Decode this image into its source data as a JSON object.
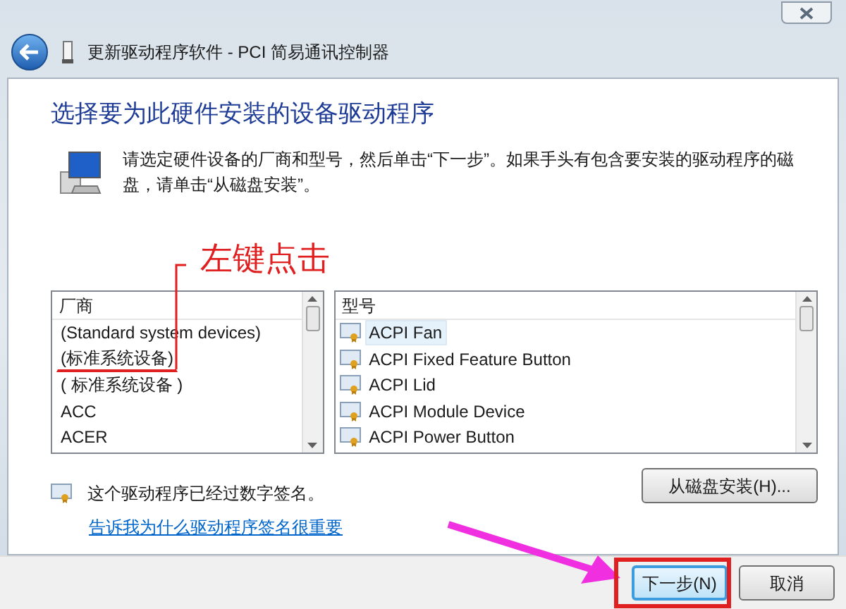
{
  "window": {
    "title": "更新驱动程序软件 - PCI 简易通讯控制器"
  },
  "heading": "选择要为此硬件安装的设备驱动程序",
  "description": "请选定硬件设备的厂商和型号，然后单击“下一步”。如果手头有包含要安装的驱动程序的磁盘，请单击“从磁盘安装”。",
  "annotation": {
    "label": "左键点击"
  },
  "manufacturer_list": {
    "header": "厂商",
    "items": [
      {
        "label": "(Standard system devices)",
        "selected": false,
        "underlined": false
      },
      {
        "label": "(标准系统设备)",
        "selected": false,
        "underlined": true
      },
      {
        "label": "( 标准系统设备 )",
        "selected": false,
        "underlined": false
      },
      {
        "label": "ACC",
        "selected": false,
        "underlined": false
      },
      {
        "label": "ACER",
        "selected": false,
        "underlined": false
      }
    ]
  },
  "model_list": {
    "header": "型号",
    "items": [
      {
        "label": "ACPI Fan",
        "selected": true
      },
      {
        "label": "ACPI Fixed Feature Button",
        "selected": false
      },
      {
        "label": "ACPI Lid",
        "selected": false
      },
      {
        "label": "ACPI Module Device",
        "selected": false
      },
      {
        "label": "ACPI Power Button",
        "selected": false
      }
    ]
  },
  "signature_note": "这个驱动程序已经过数字签名。",
  "signature_link": "告诉我为什么驱动程序签名很重要",
  "have_disk_button": "从磁盘安装(H)...",
  "buttons": [
    {
      "label": "下一步(N)",
      "highlighted": true
    },
    {
      "label": "取消",
      "highlighted": false
    }
  ]
}
